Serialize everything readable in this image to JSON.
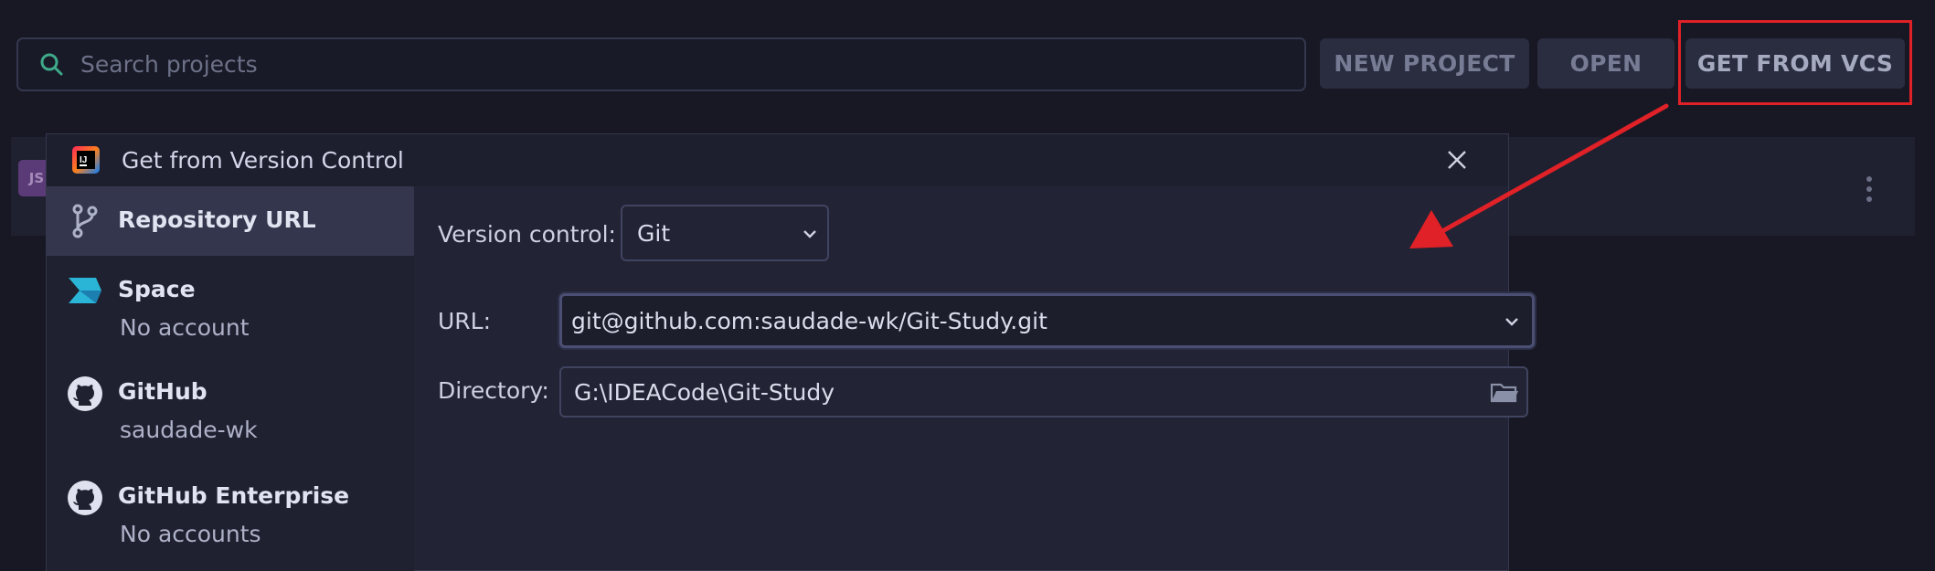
{
  "toolbar": {
    "search_placeholder": "Search projects",
    "new_project_label": "NEW PROJECT",
    "open_label": "OPEN",
    "get_from_vcs_label": "GET FROM VCS"
  },
  "project_row": {
    "badge": "JS"
  },
  "dialog": {
    "title": "Get from Version Control",
    "nav": [
      {
        "label": "Repository URL",
        "sub": "",
        "icon": "branch-icon"
      },
      {
        "label": "Space",
        "sub": "No account",
        "icon": "space-icon"
      },
      {
        "label": "GitHub",
        "sub": "saudade-wk",
        "icon": "github-icon"
      },
      {
        "label": "GitHub Enterprise",
        "sub": "No accounts",
        "icon": "github-icon"
      }
    ],
    "form": {
      "version_control_label": "Version control:",
      "version_control_value": "Git",
      "url_label": "URL:",
      "url_value": "git@github.com:saudade-wk/Git-Study.git",
      "directory_label": "Directory:",
      "directory_value": "G:\\IDEACode\\Git-Study"
    }
  },
  "colors": {
    "background": "#171824",
    "dialog": "#222334",
    "highlight": "#e02127",
    "accent_green": "#3fb68b"
  }
}
